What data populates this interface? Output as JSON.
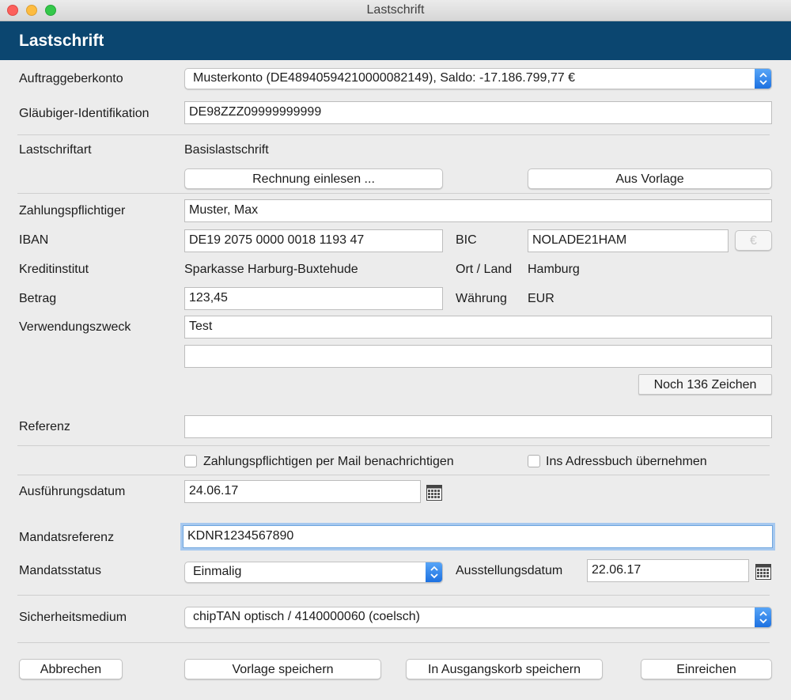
{
  "window": {
    "title": "Lastschrift",
    "heading": "Lastschrift"
  },
  "labels": {
    "auftraggeberkonto": "Auftraggeberkonto",
    "glaeubiger": "Gläubiger-Identifikation",
    "lastschriftart": "Lastschriftart",
    "zahlungspflichtiger": "Zahlungspflichtiger",
    "iban": "IBAN",
    "bic": "BIC",
    "kreditinstitut": "Kreditinstitut",
    "ort_land": "Ort / Land",
    "betrag": "Betrag",
    "waehrung": "Währung",
    "verwendungszweck": "Verwendungszweck",
    "referenz": "Referenz",
    "ausfuehrungsdatum": "Ausführungsdatum",
    "mandatsreferenz": "Mandatsreferenz",
    "mandatsstatus": "Mandatsstatus",
    "ausstellungsdatum": "Ausstellungsdatum",
    "sicherheitsmedium": "Sicherheitsmedium"
  },
  "values": {
    "auftraggeberkonto": "Musterkonto (DE48940594210000082149), Saldo: -17.186.799,77 €",
    "glaeubiger": "DE98ZZZ09999999999",
    "lastschriftart": "Basislastschrift",
    "zahlungspflichtiger": "Muster, Max",
    "iban": "DE19 2075 0000 0018 1193 47",
    "bic": "NOLADE21HAM",
    "kreditinstitut": "Sparkasse Harburg-Buxtehude",
    "ort_land": "Hamburg",
    "betrag": "123,45",
    "waehrung": "EUR",
    "verwendungszweck_1": "Test",
    "verwendungszweck_2": "",
    "referenz": "",
    "ausfuehrungsdatum": "24.06.17",
    "mandatsreferenz": "KDNR1234567890",
    "mandatsstatus": "Einmalig",
    "ausstellungsdatum": "22.06.17",
    "sicherheitsmedium": "chipTAN optisch / 4140000060 (coelsch)"
  },
  "buttons": {
    "rechnung_einlesen": "Rechnung einlesen ...",
    "aus_vorlage": "Aus Vorlage",
    "euro": "€",
    "zeichen": "Noch 136 Zeichen",
    "abbrechen": "Abbrechen",
    "vorlage_speichern": "Vorlage speichern",
    "ausgangskorb": "In Ausgangskorb speichern",
    "einreichen": "Einreichen"
  },
  "checkboxes": {
    "mail": {
      "label": "Zahlungspflichtigen per Mail benachrichtigen",
      "checked": false
    },
    "adressbuch": {
      "label": "Ins Adressbuch übernehmen",
      "checked": false
    }
  },
  "colors": {
    "banner": "#0b4670",
    "focus_ring": "#a6c8ef",
    "select_accent": "#1a6fe0"
  }
}
